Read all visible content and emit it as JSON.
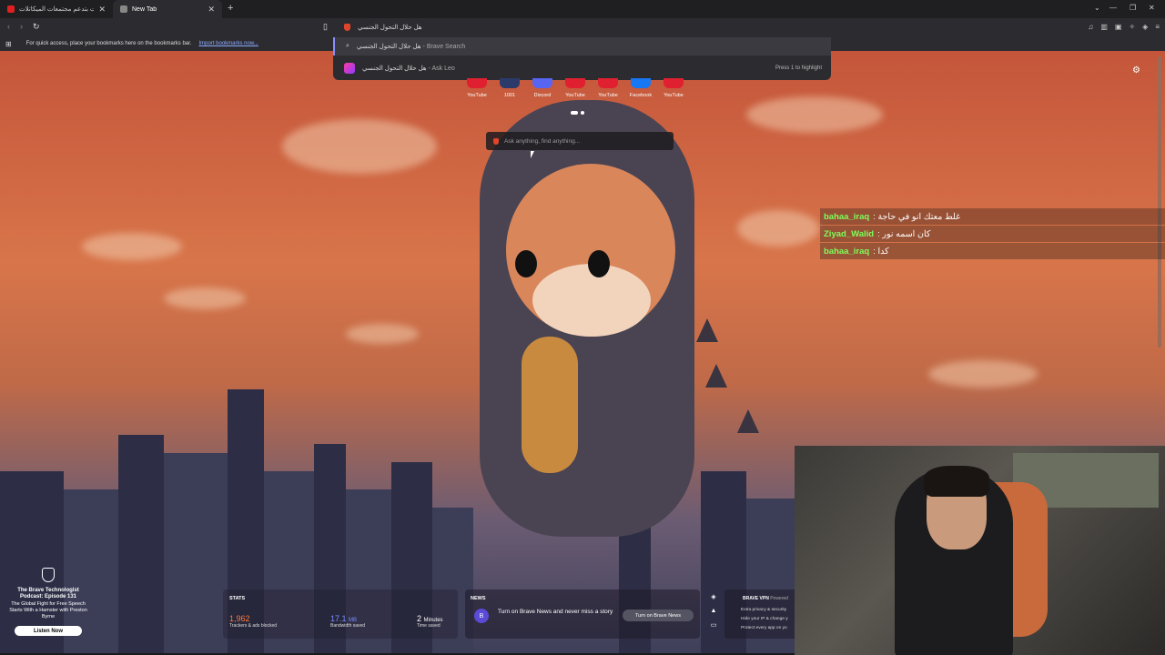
{
  "tabs": [
    {
      "title": "ليه الشركات بتدعم مجتمعات الميكاتلات",
      "favicon_color": "#e02020"
    },
    {
      "title": "New Tab",
      "favicon_color": "#888888"
    }
  ],
  "toolbar": {
    "url_text": "هل حلال التحول الجنسي"
  },
  "bookmarks_bar": {
    "message": "For quick access, place your bookmarks here on the bookmarks bar.",
    "import_link": "Import bookmarks now..."
  },
  "omnibox": {
    "suggestions": [
      {
        "query": "هل حلال التحول الجنسي",
        "source": " - Brave Search"
      },
      {
        "query": "هل حلال التحول الجنسي",
        "source": " - Ask Leo",
        "hint": "Press 1 to highlight"
      }
    ]
  },
  "top_sites": [
    {
      "label": "YouTube",
      "color": "#e02030"
    },
    {
      "label": "1001",
      "color": "#2a3a6a"
    },
    {
      "label": "Discord",
      "color": "#5865f2"
    },
    {
      "label": "YouTube",
      "color": "#e02030"
    },
    {
      "label": "YouTube",
      "color": "#e02030"
    },
    {
      "label": "Facebook",
      "color": "#1877f2"
    },
    {
      "label": "YouTube",
      "color": "#e02030"
    }
  ],
  "search": {
    "placeholder": "Ask anything, find anything..."
  },
  "chat": [
    {
      "user": "bahaa_iraq",
      "message": ": غلط معتك انو في حاجة"
    },
    {
      "user": "Ziyad_Walid",
      "message": ": كان اسمه نور"
    },
    {
      "user": "bahaa_iraq",
      "message": ": كدا"
    }
  ],
  "podcast": {
    "title": "The Brave Technologist Podcast: Episode 131",
    "subtitle": "The Global Fight for Free Speech Starts With a Hamster with Preston Byrne",
    "button": "Listen Now"
  },
  "stats": {
    "header": "STATS",
    "items": [
      {
        "value": "1,962",
        "unit": "",
        "label": "Trackers & ads blocked"
      },
      {
        "value": "17.1",
        "unit": "MB",
        "label": "Bandwidth saved"
      },
      {
        "value": "2",
        "unit": "Minutes",
        "label": "Time saved"
      }
    ]
  },
  "news": {
    "header": "NEWS",
    "text": "Turn on Brave News and never miss a story",
    "button": "Turn on Brave News"
  },
  "vpn": {
    "header": "BRAVE VPN",
    "powered": "Powered",
    "lines": [
      "Extra privacy & security",
      "Hide your IP & change y",
      "Protect every app on yo"
    ]
  }
}
